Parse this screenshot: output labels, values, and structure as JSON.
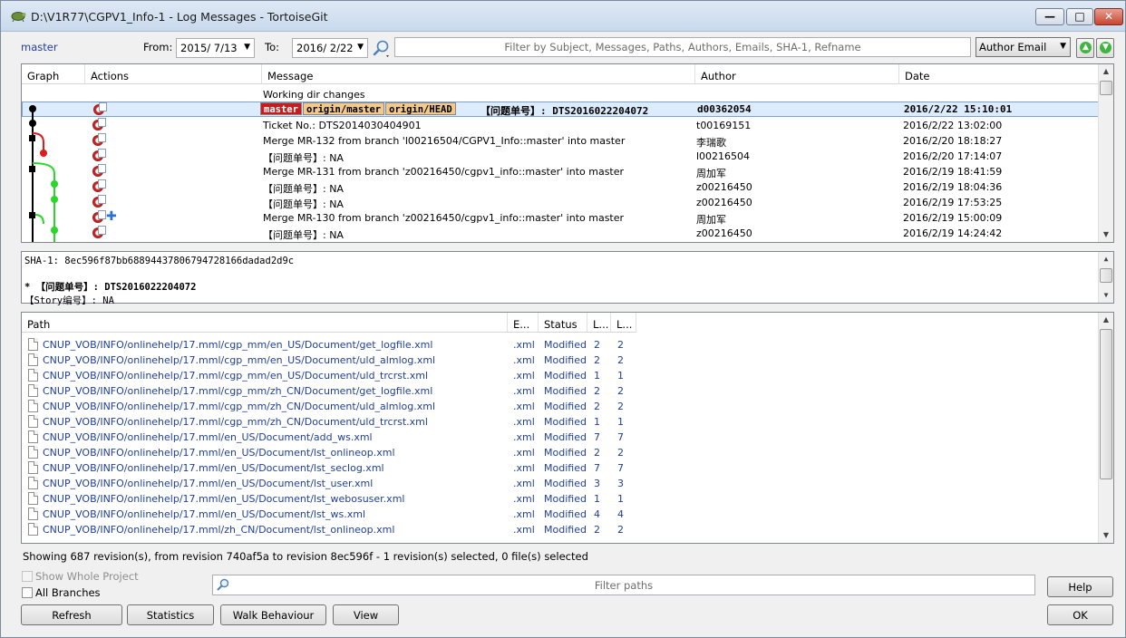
{
  "window": {
    "title": "D:\\V1R77\\CGPV1_Info-1 - Log Messages - TortoiseGit",
    "min_label": "—",
    "max_label": "□",
    "close_label": "✕"
  },
  "toolbar": {
    "branch": "master",
    "from_label": "From:",
    "from_value": "2015/ 7/13",
    "to_label": "To:",
    "to_value": "2016/ 2/22",
    "filter_placeholder": "Filter by Subject, Messages, Paths, Authors, Emails, SHA-1, Refname",
    "filter_field": "Author Email",
    "up_icon": "green-up-arrow-icon",
    "down_icon": "green-down-arrow-icon"
  },
  "log": {
    "columns": [
      "Graph",
      "Actions",
      "Message",
      "Author",
      "Date"
    ],
    "working_dir": "Working dir changes",
    "selected": {
      "refs": [
        "master",
        "origin/master",
        "origin/HEAD"
      ],
      "message": "【问题单号】:  DTS2016022204072",
      "author": "d00362054",
      "date": "2016/2/22 15:10:01"
    },
    "rows": [
      {
        "message": "Ticket No.: DTS2014030404901",
        "author": "t00169151",
        "date": "2016/2/22 13:02:00"
      },
      {
        "message": "Merge MR-132 from branch 'l00216504/CGPV1_Info::master' into master",
        "author": "李瑞歌",
        "date": "2016/2/20 18:18:27"
      },
      {
        "message": "【问题单号】:  NA",
        "author": "l00216504",
        "date": "2016/2/20 17:14:07"
      },
      {
        "message": "Merge MR-131 from branch 'z00216450/cgpv1_info::master' into master",
        "author": "周加军",
        "date": "2016/2/19 18:41:59"
      },
      {
        "message": "【问题单号】:  NA",
        "author": "z00216450",
        "date": "2016/2/19 18:04:36"
      },
      {
        "message": "【问题单号】:  NA",
        "author": "z00216450",
        "date": "2016/2/19 17:53:25"
      },
      {
        "message": "Merge MR-130 from branch 'z00216450/cgpv1_info::master' into master",
        "author": "周加军",
        "date": "2016/2/19 15:00:09"
      },
      {
        "message": "【问题单号】:  NA",
        "author": "z00216450",
        "date": "2016/2/19 14:24:42"
      }
    ]
  },
  "message_panel": {
    "sha": "SHA-1: 8ec596f87bb68894437806794728166dadad2d9c",
    "line1": "* 【问题单号】:   DTS2016022204072",
    "line2": "【Story编号】:  NA"
  },
  "files": {
    "columns": [
      "Path",
      "E...",
      "Status",
      "L...",
      "L..."
    ],
    "rows": [
      {
        "path": "CNUP_VOB/INFO/onlinehelp/17.mml/cgp_mm/en_US/Document/get_logfile.xml",
        "ext": ".xml",
        "status": "Modified",
        "a": "2",
        "b": "2"
      },
      {
        "path": "CNUP_VOB/INFO/onlinehelp/17.mml/cgp_mm/en_US/Document/uld_almlog.xml",
        "ext": ".xml",
        "status": "Modified",
        "a": "2",
        "b": "2"
      },
      {
        "path": "CNUP_VOB/INFO/onlinehelp/17.mml/cgp_mm/en_US/Document/uld_trcrst.xml",
        "ext": ".xml",
        "status": "Modified",
        "a": "1",
        "b": "1"
      },
      {
        "path": "CNUP_VOB/INFO/onlinehelp/17.mml/cgp_mm/zh_CN/Document/get_logfile.xml",
        "ext": ".xml",
        "status": "Modified",
        "a": "2",
        "b": "2"
      },
      {
        "path": "CNUP_VOB/INFO/onlinehelp/17.mml/cgp_mm/zh_CN/Document/uld_almlog.xml",
        "ext": ".xml",
        "status": "Modified",
        "a": "2",
        "b": "2"
      },
      {
        "path": "CNUP_VOB/INFO/onlinehelp/17.mml/cgp_mm/zh_CN/Document/uld_trcrst.xml",
        "ext": ".xml",
        "status": "Modified",
        "a": "1",
        "b": "1"
      },
      {
        "path": "CNUP_VOB/INFO/onlinehelp/17.mml/en_US/Document/add_ws.xml",
        "ext": ".xml",
        "status": "Modified",
        "a": "7",
        "b": "7"
      },
      {
        "path": "CNUP_VOB/INFO/onlinehelp/17.mml/en_US/Document/lst_onlineop.xml",
        "ext": ".xml",
        "status": "Modified",
        "a": "2",
        "b": "2"
      },
      {
        "path": "CNUP_VOB/INFO/onlinehelp/17.mml/en_US/Document/lst_seclog.xml",
        "ext": ".xml",
        "status": "Modified",
        "a": "7",
        "b": "7"
      },
      {
        "path": "CNUP_VOB/INFO/onlinehelp/17.mml/en_US/Document/lst_user.xml",
        "ext": ".xml",
        "status": "Modified",
        "a": "3",
        "b": "3"
      },
      {
        "path": "CNUP_VOB/INFO/onlinehelp/17.mml/en_US/Document/lst_webosuser.xml",
        "ext": ".xml",
        "status": "Modified",
        "a": "1",
        "b": "1"
      },
      {
        "path": "CNUP_VOB/INFO/onlinehelp/17.mml/en_US/Document/lst_ws.xml",
        "ext": ".xml",
        "status": "Modified",
        "a": "4",
        "b": "4"
      },
      {
        "path": "CNUP_VOB/INFO/onlinehelp/17.mml/zh_CN/Document/lst_onlineop.xml",
        "ext": ".xml",
        "status": "Modified",
        "a": "2",
        "b": "2"
      }
    ]
  },
  "status_text": "Showing 687 revision(s), from revision 740af5a to revision 8ec596f - 1 revision(s) selected, 0 file(s) selected",
  "options": {
    "show_whole_project": "Show Whole Project",
    "all_branches": "All Branches"
  },
  "path_filter_placeholder": "Filter paths",
  "buttons": {
    "help": "Help",
    "refresh": "Refresh",
    "statistics": "Statistics",
    "walk": "Walk Behaviour",
    "view": "View",
    "ok": "OK"
  },
  "colors": {
    "graph_black": "#000000",
    "graph_red": "#e01b1b",
    "graph_green": "#2ad62a",
    "link_blue": "#1f3f99",
    "selection": "#ddecfc"
  }
}
